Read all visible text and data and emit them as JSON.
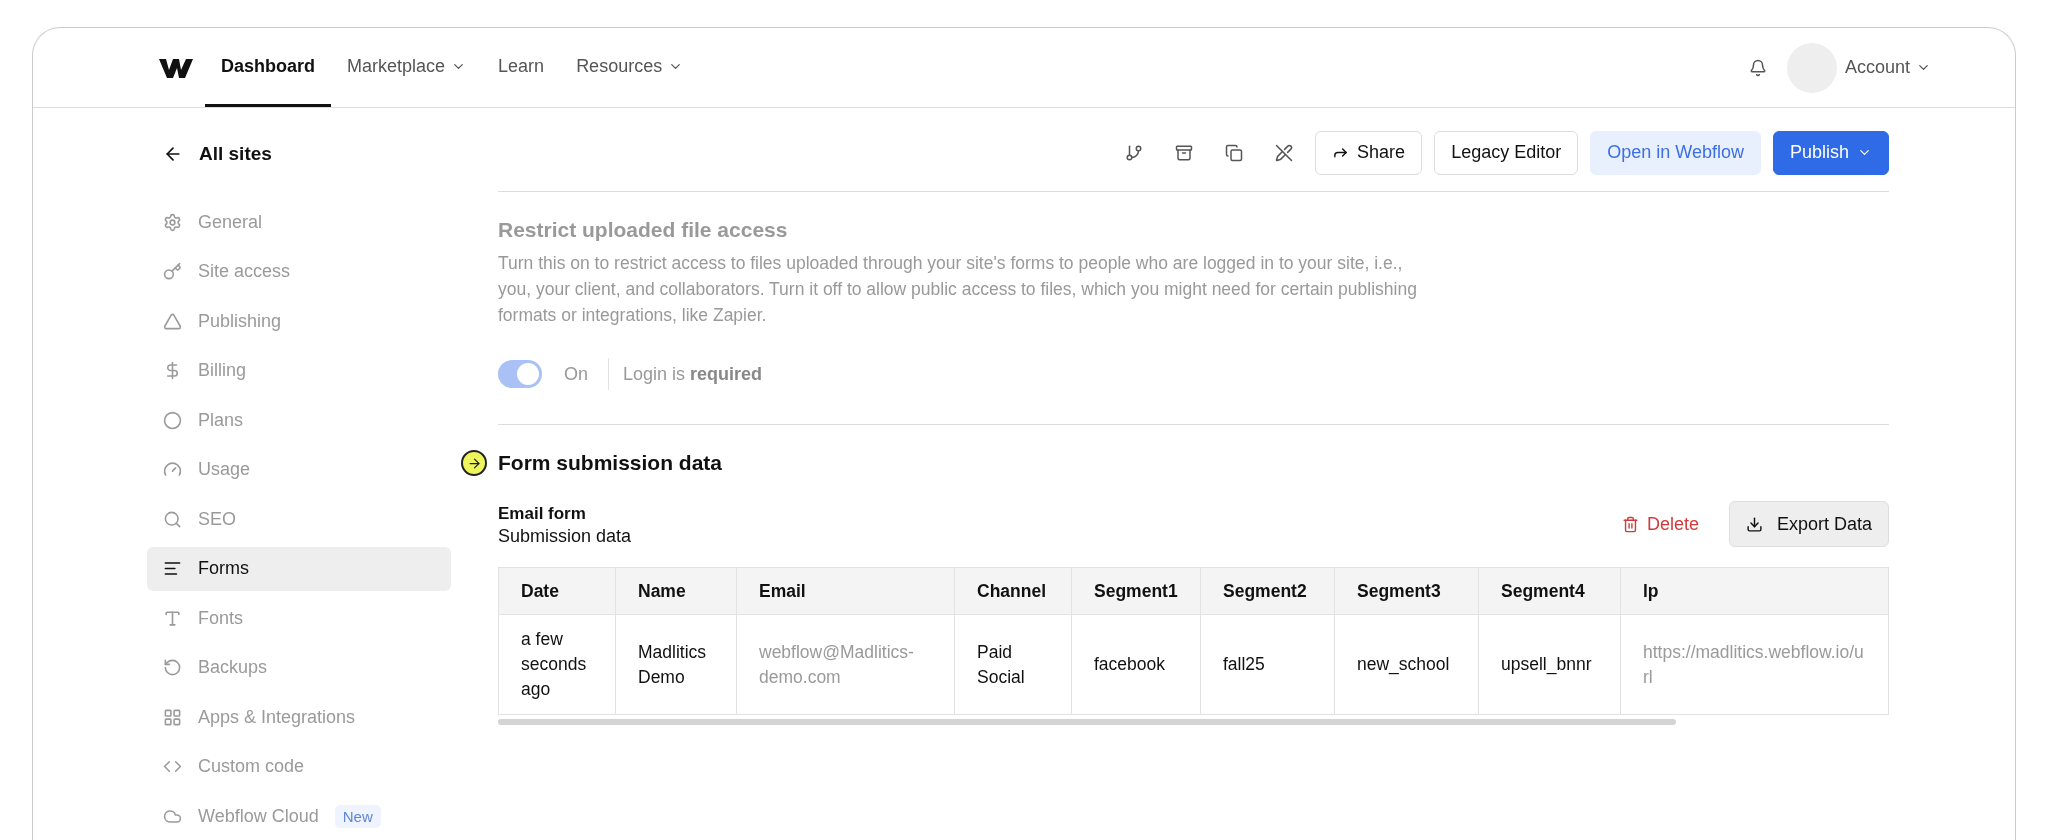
{
  "nav": {
    "items": [
      {
        "label": "Dashboard",
        "selected": true,
        "dropdown": false
      },
      {
        "label": "Marketplace",
        "selected": false,
        "dropdown": true
      },
      {
        "label": "Learn",
        "selected": false,
        "dropdown": false
      },
      {
        "label": "Resources",
        "selected": false,
        "dropdown": true
      }
    ],
    "account": "Account"
  },
  "sidebar": {
    "back": "All sites",
    "items": [
      {
        "label": "General",
        "selected": false,
        "muted": true
      },
      {
        "label": "Site access",
        "selected": false,
        "muted": true
      },
      {
        "label": "Publishing",
        "selected": false,
        "muted": true
      },
      {
        "label": "Billing",
        "selected": false,
        "muted": true
      },
      {
        "label": "Plans",
        "selected": false,
        "muted": true
      },
      {
        "label": "Usage",
        "selected": false,
        "muted": true
      },
      {
        "label": "SEO",
        "selected": false,
        "muted": true
      },
      {
        "label": "Forms",
        "selected": true,
        "muted": false
      },
      {
        "label": "Fonts",
        "selected": false,
        "muted": true
      },
      {
        "label": "Backups",
        "selected": false,
        "muted": true
      },
      {
        "label": "Apps & Integrations",
        "selected": false,
        "muted": true
      },
      {
        "label": "Custom code",
        "selected": false,
        "muted": true
      },
      {
        "label": "Webflow Cloud",
        "selected": false,
        "muted": true,
        "badge": "New"
      }
    ]
  },
  "toolbar": {
    "buttons": [
      {
        "label": "Share",
        "kind": "outline"
      },
      {
        "label": "Legacy Editor",
        "kind": "outline"
      },
      {
        "label": "Open in Webflow",
        "kind": "soft"
      },
      {
        "label": "Publish",
        "kind": "primary"
      }
    ]
  },
  "restrict": {
    "title": "Restrict uploaded file access",
    "description": "Turn this on to restrict access to files uploaded through your site's forms to people who are logged in to your site, i.e., you, your client, and collaborators. Turn it off to allow public access to files, which you might need for certain publishing formats or integrations, like Zapier.",
    "toggle": {
      "on": true,
      "label": "On"
    },
    "status": "Login is **required**"
  },
  "submissions": {
    "title": "Form submission data",
    "form_name": "Email form",
    "subtitle": "Submission data",
    "delete": "Delete",
    "export": "Export Data",
    "table": {
      "columns": [
        "Date",
        "Name",
        "Email",
        "Channel",
        "Segment1",
        "Segment2",
        "Segment3",
        "Segment4",
        "lp"
      ],
      "rows": [
        {
          "cells": [
            {
              "text": "a few seconds ago",
              "muted": false
            },
            {
              "text": "Madlitics Demo",
              "muted": false
            },
            {
              "text": "webflow@Madlitics-demo.com",
              "muted": true
            },
            {
              "text": "Paid Social",
              "muted": false
            },
            {
              "text": "facebook",
              "muted": false
            },
            {
              "text": "fall25",
              "muted": false
            },
            {
              "text": "new_school",
              "muted": false
            },
            {
              "text": "upsell_bnnr",
              "muted": false
            },
            {
              "text": "https://madlitics.webflow.io/url",
              "muted": true
            }
          ]
        }
      ]
    }
  }
}
